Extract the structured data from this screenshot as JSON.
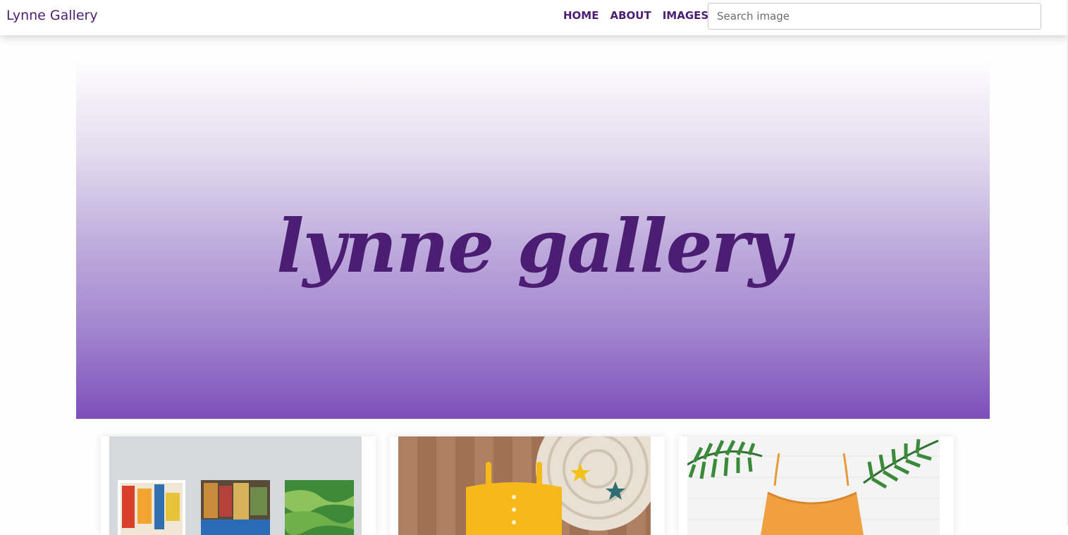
{
  "navbar": {
    "brand": "Lynne Gallery",
    "links": [
      "HOME",
      "ABOUT",
      "IMAGES"
    ],
    "search": {
      "placeholder": "Search image",
      "value": ""
    }
  },
  "hero": {
    "title": "lynne gallery"
  },
  "cards": [
    {
      "image_icon": "canvas-paintings-image"
    },
    {
      "image_icon": "yellow-top-flatlay-image"
    },
    {
      "image_icon": "orange-swimsuit-image"
    }
  ],
  "colors": {
    "brand": "#4b1d73",
    "hero_gradient_top": "#fdfcfe",
    "hero_gradient_bottom": "#7d4fba"
  }
}
